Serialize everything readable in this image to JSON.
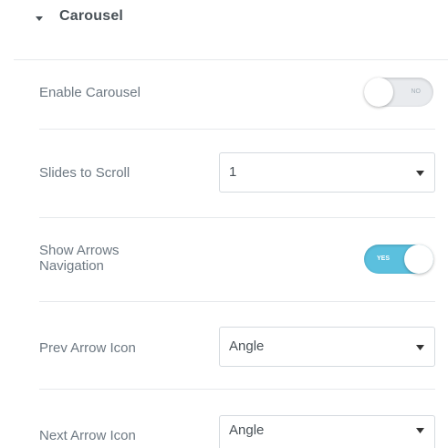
{
  "section": {
    "title": "Carousel",
    "caret_icon": "caret-down-icon"
  },
  "enable_carousel": {
    "label": "Enable Carousel",
    "switch_text": "NO",
    "on": false
  },
  "slides_to_scroll": {
    "label": "Slides to Scroll",
    "value": "1",
    "arrow_icon": "caret-down-icon"
  },
  "show_arrows": {
    "label_line1": "Show Arrows",
    "label_line2": "Navigation",
    "switch_text": "YES",
    "on": true
  },
  "prev_arrow_icon": {
    "label": "Prev Arrow Icon",
    "value": "Angle",
    "arrow_icon": "caret-down-icon"
  },
  "next_arrow_icon": {
    "label": "Next Arrow Icon",
    "value": "Angle",
    "arrow_icon": "caret-down-icon"
  },
  "colors": {
    "switch_on": "#5bc0de",
    "switch_off": "#e9ebee",
    "label": "#6d7882",
    "title": "#495157",
    "separator": "#e6e9ec"
  }
}
